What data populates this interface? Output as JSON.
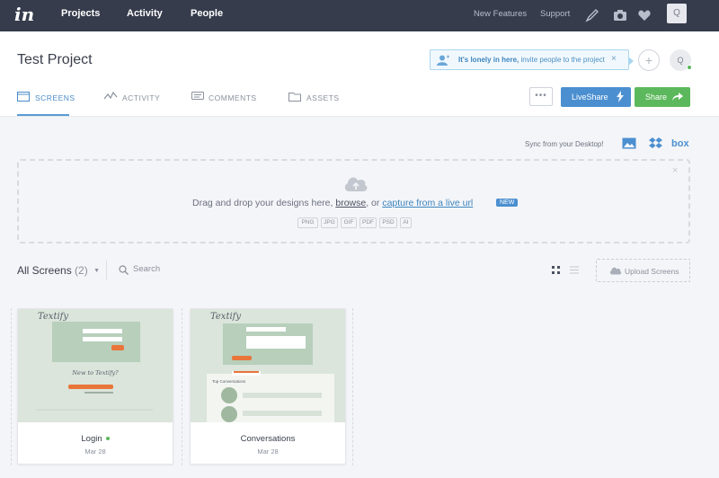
{
  "topnav": {
    "logo": "in",
    "links": [
      "Projects",
      "Activity",
      "People"
    ],
    "new_features": "New Features",
    "support": "Support",
    "avatar_initial": "Q",
    "icons": [
      "pen-icon",
      "camera-icon",
      "heart-icon"
    ]
  },
  "header": {
    "project_title": "Test Project",
    "lonely_bold": "It's lonely in here,",
    "lonely_rest": " invite people to the project",
    "lonely_close": "×",
    "plus": "+",
    "user_initial": "Q",
    "tabs": [
      "SCREENS",
      "ACTIVITY",
      "COMMENTS",
      "ASSETS"
    ],
    "more": "•••",
    "liveshare": "LiveShare",
    "share": "Share"
  },
  "sync": {
    "label": "Sync from your Desktop!",
    "box": "box"
  },
  "dropzone": {
    "text_pre": "Drag and drop your designs here, ",
    "browse": "browse",
    "text_mid": ", or ",
    "capture": "capture from a live url",
    "new_badge": "NEW",
    "close": "×",
    "formats": [
      "PNG",
      "JPG",
      "GIF",
      "PDF",
      "PSD",
      "AI"
    ]
  },
  "toolbar": {
    "all_screens": "All Screens",
    "count": "(2)",
    "search_placeholder": "Search",
    "upload": "Upload Screens"
  },
  "screens": [
    {
      "name": "Login",
      "date": "Mar 28",
      "thumb_logo": "Textify",
      "thumb_heading": "New to Textify?"
    },
    {
      "name": "Conversations",
      "date": "Mar 28",
      "thumb_logo": "Textify",
      "thumb_heading": "Top Conversations"
    }
  ],
  "colors": {
    "nav_bg": "#363c4c",
    "accent_blue": "#4b8fd0",
    "accent_green": "#5cb85c",
    "page_bg": "#f4f5f8"
  }
}
